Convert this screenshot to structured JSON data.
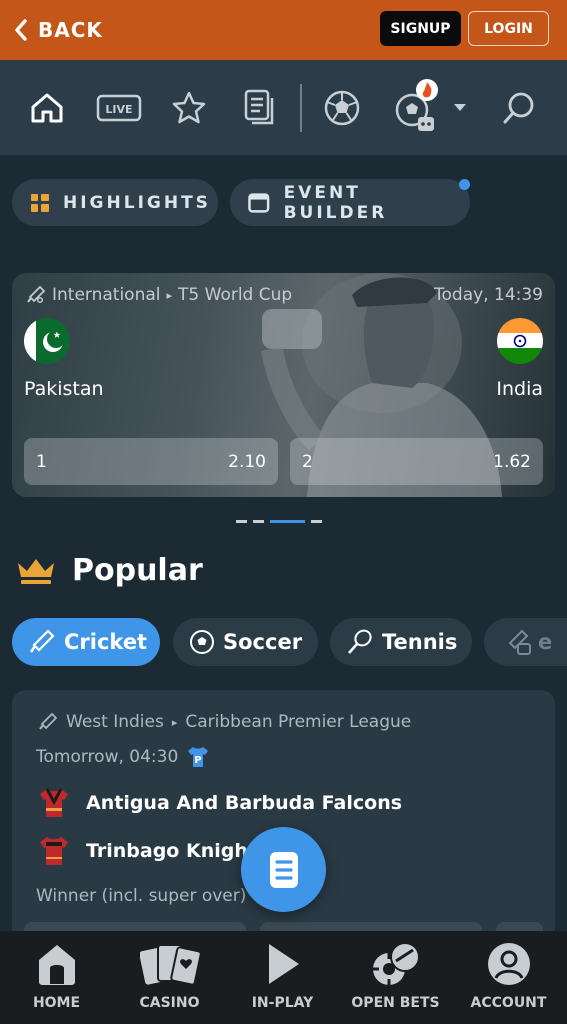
{
  "header": {
    "back_label": "BACK",
    "signup_label": "SIGNUP",
    "login_label": "LOGIN"
  },
  "nav": {
    "live_label": "LIVE"
  },
  "pills": {
    "highlights": "HIGHLIGHTS",
    "event_builder": "EVENT BUILDER"
  },
  "featured": {
    "region": "International",
    "competition": "T5 World Cup",
    "time": "Today, 14:39",
    "home": "Pakistan",
    "away": "India",
    "odds": [
      {
        "label": "1",
        "value": "2.10"
      },
      {
        "label": "2",
        "value": "1.62"
      }
    ]
  },
  "popular": {
    "title": "Popular"
  },
  "sports": [
    {
      "label": "Cricket",
      "icon": "cricket-bat-icon"
    },
    {
      "label": "Soccer",
      "icon": "soccer-ball-icon"
    },
    {
      "label": "Tennis",
      "icon": "tennis-racket-icon"
    },
    {
      "label": "e",
      "icon": "esports-icon"
    }
  ],
  "match": {
    "region": "West Indies",
    "competition": "Caribbean Premier League",
    "time": "Tomorrow, 04:30",
    "home": "Antigua And Barbuda Falcons",
    "away": "Trinbago Knight",
    "market": "Winner (incl. super over)"
  },
  "bottom_nav": [
    "HOME",
    "CASINO",
    "IN-PLAY",
    "OPEN BETS",
    "ACCOUNT"
  ],
  "colors": {
    "header": "#c4561a",
    "accent": "#3f95e8",
    "background": "#1c2a34"
  }
}
